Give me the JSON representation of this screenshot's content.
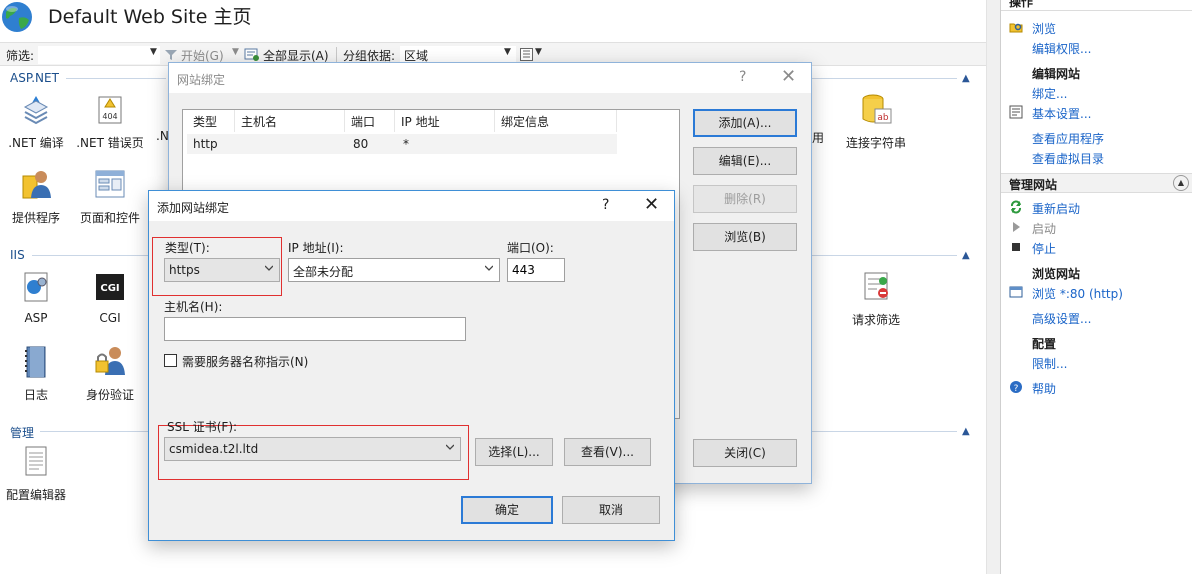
{
  "window": {
    "title": "Default Web Site 主页"
  },
  "toolbar": {
    "filter_label": "筛选:",
    "start_label": "开始(G)",
    "show_all_label": "全部显示(A)",
    "group_by_label": "分组依据:",
    "group_by_value": "区域"
  },
  "groups": {
    "aspnet": "ASP.NET",
    "iis": "IIS",
    "management": "管理"
  },
  "features": {
    "net_compile": ".NET 编译",
    "net_error": ".NET 错误页",
    "net_truncated": ".N",
    "providers": "提供程序",
    "pages_controls": "页面和控件",
    "asp": "ASP",
    "cgi": "CGI",
    "cgi_icon_text": "CGI",
    "error_icon_text": "404",
    "logging": "日志",
    "authentication": "身份验证",
    "config_editor": "配置编辑器",
    "conn_strings": "连接字符串",
    "conn_strings_partial": "用",
    "request_filtering": "请求筛选",
    "ab_icon_text": "ab"
  },
  "actions": {
    "header": "操作",
    "browse": "浏览",
    "edit_permissions": "编辑权限...",
    "edit_site_header": "编辑网站",
    "bindings": "绑定...",
    "basic_settings": "基本设置...",
    "view_apps": "查看应用程序",
    "view_vdirs": "查看虚拟目录",
    "manage_site_section": "管理网站",
    "restart": "重新启动",
    "start": "启动",
    "stop": "停止",
    "browse_site_header": "浏览网站",
    "browse_80": "浏览 *:80 (http)",
    "advanced_settings": "高级设置...",
    "config_header": "配置",
    "limits": "限制...",
    "help": "帮助"
  },
  "site_bindings": {
    "title": "网站绑定",
    "help": "?",
    "close": "✕",
    "columns": [
      "类型",
      "主机名",
      "端口",
      "IP 地址",
      "绑定信息"
    ],
    "rows": [
      {
        "type": "http",
        "host": "",
        "port": "80",
        "ip": "*",
        "info": ""
      }
    ],
    "add_button": "添加(A)...",
    "edit_button": "编辑(E)...",
    "remove_button": "删除(R)",
    "browse_button": "浏览(B)",
    "close_button": "关闭(C)"
  },
  "add_binding": {
    "title": "添加网站绑定",
    "help": "?",
    "close": "✕",
    "type_label": "类型(T):",
    "type_value": "https",
    "ip_label": "IP 地址(I):",
    "ip_value": "全部未分配",
    "port_label": "端口(O):",
    "port_value": "443",
    "host_label": "主机名(H):",
    "host_value": "",
    "sni_label": "需要服务器名称指示(N)",
    "sni_checked": false,
    "ssl_label": "SSL 证书(F):",
    "ssl_value": "csmidea.t2l.ltd",
    "select_button": "选择(L)...",
    "view_button": "查看(V)...",
    "ok_button": "确定",
    "cancel_button": "取消"
  },
  "colors": {
    "accent": "#2b7ad6",
    "link": "#1a64c8",
    "highlight_red": "#e03030",
    "group_header": "#1c4f8c"
  }
}
